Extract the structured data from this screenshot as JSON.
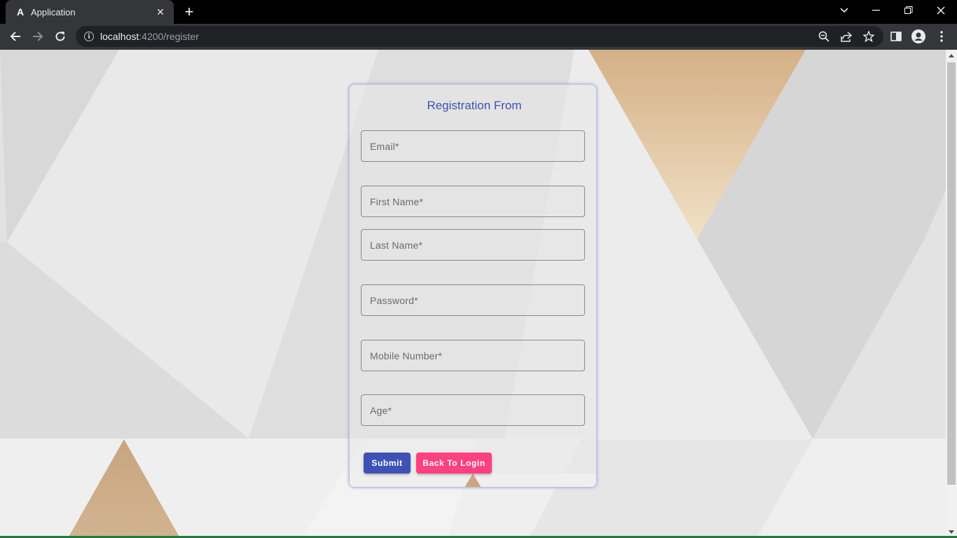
{
  "browser": {
    "tab_title": "Application",
    "tab_favicon": "A",
    "url_host": "localhost",
    "url_rest": ":4200/register"
  },
  "form": {
    "title": "Registration From",
    "fields": {
      "email": "Email*",
      "first_name": "First Name*",
      "last_name": "Last Name*",
      "password": "Password*",
      "mobile": "Mobile Number*",
      "age": "Age*"
    },
    "submit_label": "Submit",
    "back_label": "Back To Login"
  },
  "colors": {
    "primary": "#3f51b5",
    "accent": "#ff4081",
    "background_tan": "#cda67f"
  }
}
